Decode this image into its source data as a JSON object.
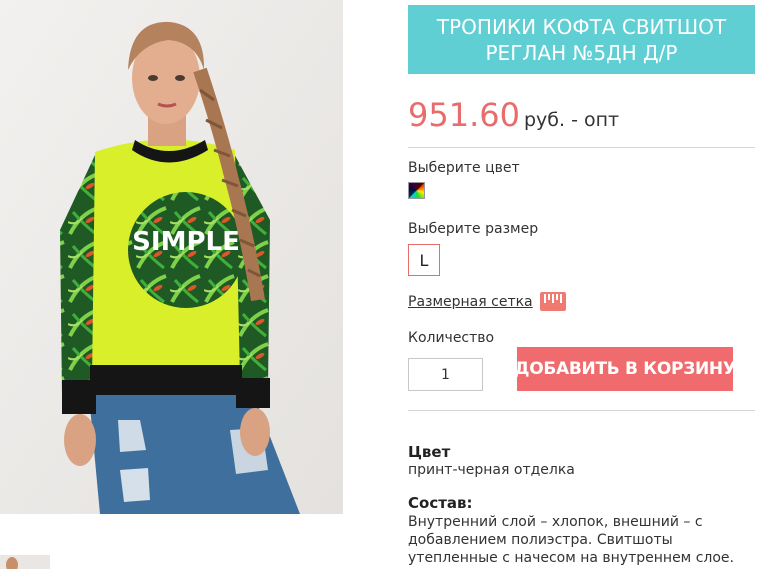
{
  "product": {
    "title": "ТРОПИКИ КОФТА СВИТШОТ РЕГЛАН №5ДН Д/Р",
    "price_value": "951.60",
    "price_suffix": "руб. - опт",
    "print_text": "SIMPLE"
  },
  "options": {
    "color_label": "Выберите цвет",
    "color_swatch_icon": "multicolor-swatch-icon",
    "size_label": "Выберите размер",
    "size_value": "L",
    "size_chart_link": "Размерная сетка",
    "size_chart_icon": "ruler-icon"
  },
  "cart": {
    "quantity_label": "Количество",
    "quantity_value": "1",
    "add_button_label": "ДОБАВИТЬ В КОРЗИНУ"
  },
  "specs": {
    "color_title": "Цвет",
    "color_value": "принт-черная отделка",
    "composition_title": "Состав:",
    "composition_text": "Внутренний слой – хлопок, внешний – с добавлением полиэстра. Свитшоты утепленные с начесом на внутреннем слое."
  },
  "colors": {
    "title_bg": "#5fcfd4",
    "price": "#e86c6c",
    "button_bg": "#f06b6d",
    "size_border": "#e86c6c",
    "ruler_icon": "#ef7a72"
  }
}
